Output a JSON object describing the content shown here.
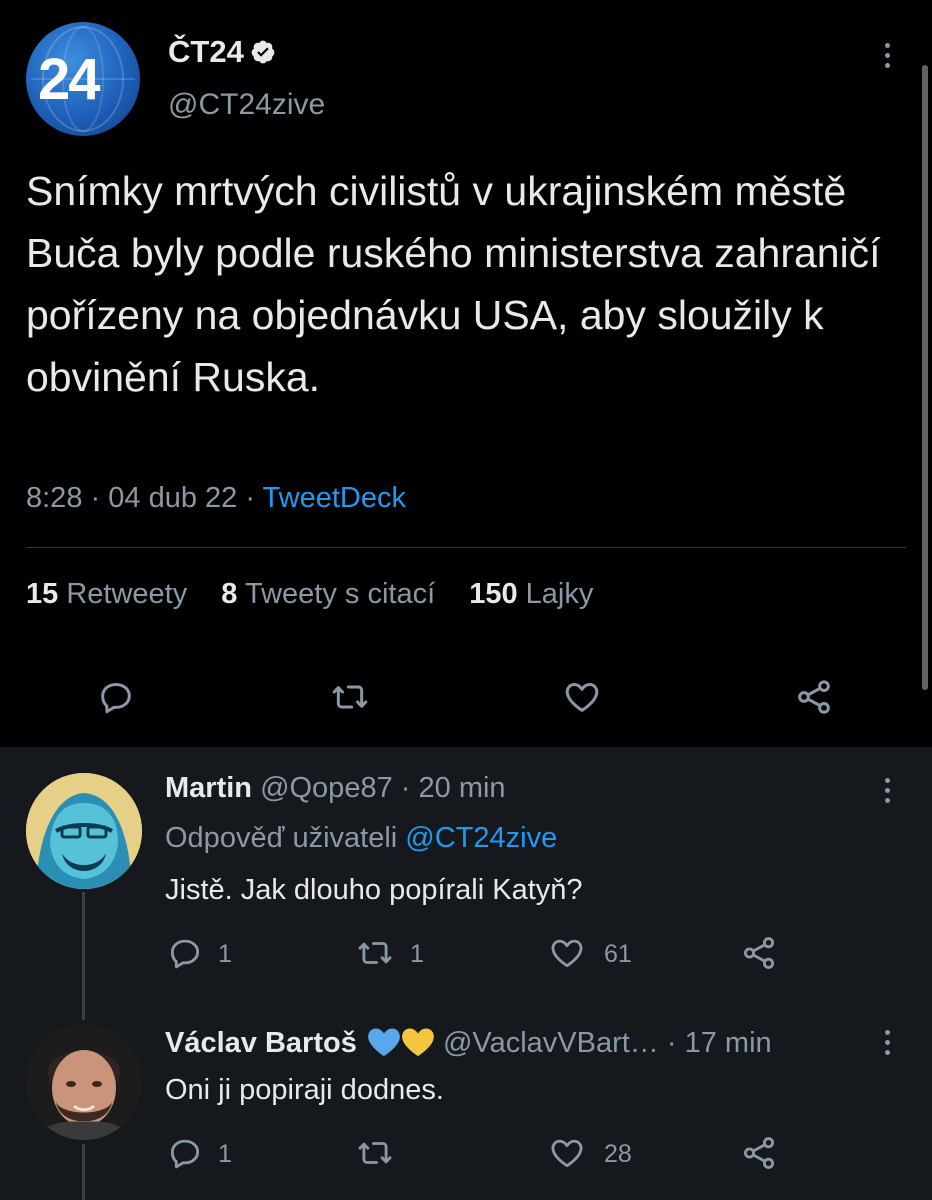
{
  "tweet": {
    "author_name": "ČT24",
    "author_handle": "@CT24zive",
    "avatar_text": "24",
    "text": "Snímky mrtvých civilistů v ukrajinském městě Buča byly podle ruského ministerstva zahraničí pořízeny na objednávku USA, aby sloužily k obvinění Ruska.",
    "time": "8:28",
    "date": "04 dub 22",
    "separator": "·",
    "source": "TweetDeck",
    "stats": {
      "retweets_count": "15",
      "retweets_label": "Retweety",
      "quotes_count": "8",
      "quotes_label": "Tweety s citací",
      "likes_count": "150",
      "likes_label": "Lajky"
    },
    "actions": [
      "reply-icon",
      "retweet-icon",
      "like-icon",
      "share-icon"
    ]
  },
  "replies": [
    {
      "name": "Martin",
      "handle": "@Qope87",
      "separator": "·",
      "time": "20 min",
      "replying_prefix": "Odpověď uživateli",
      "replying_to": "@CT24zive",
      "text": "Jistě. Jak dlouho popírali Katyň?",
      "reply_count": "1",
      "retweet_count": "1",
      "like_count": "61"
    },
    {
      "name": "Václav Bartoš",
      "emoji_hearts": [
        "blue-heart",
        "yellow-heart"
      ],
      "handle": "@VaclavVBart…",
      "separator": "·",
      "time": "17 min",
      "text": "Oni ji popiraji dodnes.",
      "reply_count": "1",
      "retweet_count": "",
      "like_count": "28"
    }
  ],
  "colors": {
    "background": "#000000",
    "thread_background": "#15181c",
    "text": "#e7e9ea",
    "secondary": "#8b98a5",
    "link": "#1d9bf0",
    "verified": "#e7e9ea"
  }
}
